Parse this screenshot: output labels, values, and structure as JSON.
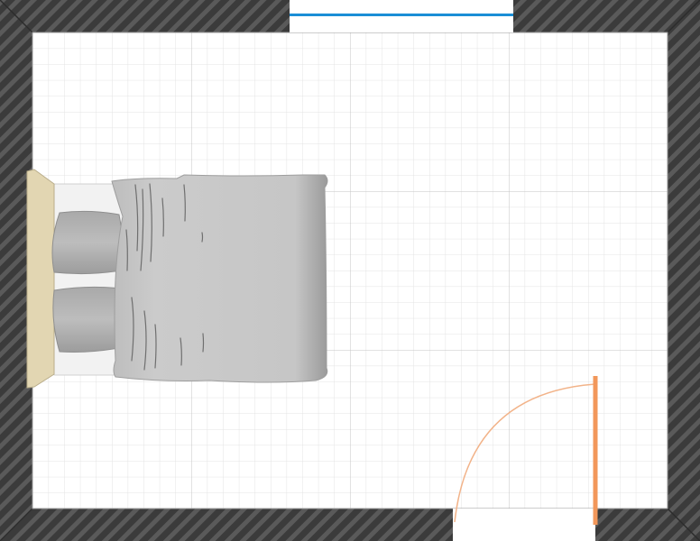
{
  "plan": {
    "view": "floor-plan-top-down",
    "room": {
      "floor_style": "grid",
      "wall_style": "hatched-dark"
    },
    "objects": [
      {
        "name": "window",
        "wall": "top",
        "kind": "window"
      },
      {
        "name": "double-bed",
        "kind": "bed",
        "pillows": 2
      },
      {
        "name": "door",
        "wall": "bottom",
        "kind": "door",
        "swing": "inward-left"
      }
    ]
  },
  "colors": {
    "wall_fill": "#3b3b3b",
    "wall_hatch": "#5a5a5a",
    "floor": "#ffffff",
    "grid_minor": "#e3e3e3",
    "grid_major": "#c4c4c4",
    "window_line": "#1a8ed6",
    "door": "#f2975a",
    "headboard": "#e2d6b2",
    "duvet": "#c9c9c9",
    "pillow": "#b8b8b8",
    "sheet": "#f2f2f2"
  }
}
